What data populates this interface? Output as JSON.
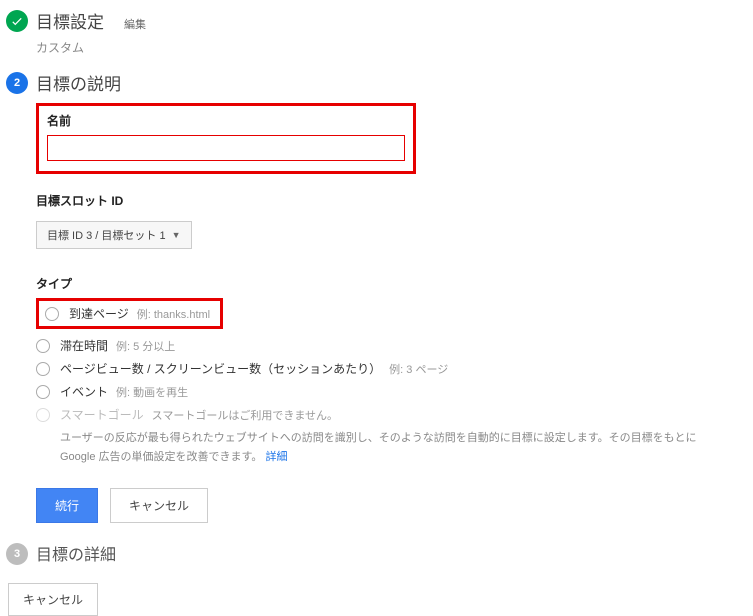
{
  "step1": {
    "title": "目標設定",
    "edit": "編集",
    "subtitle": "カスタム"
  },
  "step2": {
    "number": "2",
    "title": "目標の説明",
    "nameLabel": "名前",
    "nameValue": "",
    "slotLabel": "目標スロット ID",
    "slotValue": "目標 ID 3 / 目標セット 1",
    "typeLabel": "タイプ",
    "types": {
      "destination": {
        "label": "到達ページ",
        "example": "例: thanks.html"
      },
      "duration": {
        "label": "滞在時間",
        "example": "例: 5 分以上"
      },
      "pageviews": {
        "label": "ページビュー数 / スクリーンビュー数（セッションあたり）",
        "example": "例: 3 ページ"
      },
      "event": {
        "label": "イベント",
        "example": "例: 動画を再生"
      },
      "smart": {
        "label": "スマートゴール",
        "example": "スマートゴールはご利用できません。"
      }
    },
    "smartDesc": "ユーザーの反応が最も得られたウェブサイトへの訪問を識別し、そのような訪問を自動的に目標に設定します。その目標をもとに Google 広告の単価設定を改善できます。",
    "smartLink": "詳細",
    "continueBtn": "続行",
    "cancelBtn": "キャンセル"
  },
  "step3": {
    "number": "3",
    "title": "目標の詳細"
  },
  "bottomCancel": "キャンセル"
}
